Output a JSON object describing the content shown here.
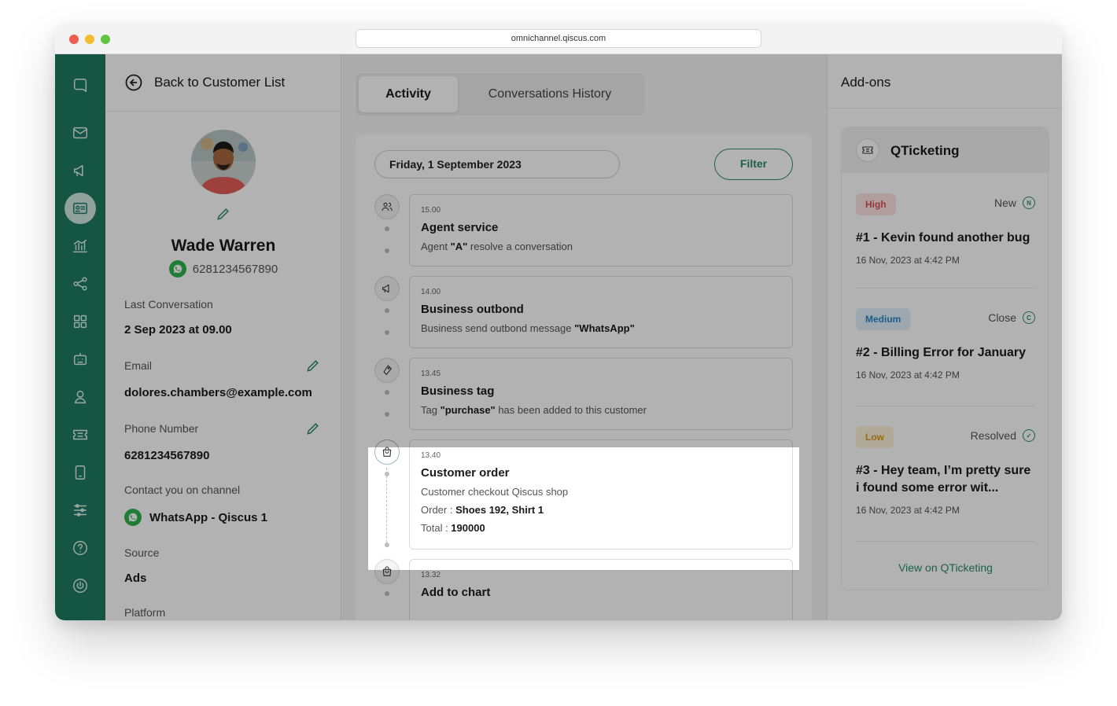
{
  "browser": {
    "url": "omnichannel.qiscus.com"
  },
  "nav": {
    "items": [
      "logo",
      "mail",
      "broadcast",
      "contacts",
      "analytics",
      "integrations",
      "apps",
      "bot",
      "agents",
      "tickets",
      "mobile",
      "settings",
      "help",
      "power"
    ]
  },
  "profile": {
    "back_label": "Back to Customer List",
    "name": "Wade Warren",
    "phone": "6281234567890",
    "last_conversation_label": "Last Conversation",
    "last_conversation_value": "2 Sep 2023 at 09.00",
    "email_label": "Email",
    "email_value": "dolores.chambers@example.com",
    "phone_label": "Phone Number",
    "phone_value": "6281234567890",
    "channel_label": "Contact you on channel",
    "channel_value": "WhatsApp - Qiscus 1",
    "source_label": "Source",
    "source_value": "Ads",
    "platform_label": "Platform"
  },
  "activity": {
    "tabs": [
      "Activity",
      "Conversations History"
    ],
    "date": "Friday, 1 September 2023",
    "filter_label": "Filter",
    "events": [
      {
        "icon": "users-icon",
        "time": "15.00",
        "title": "Agent service",
        "desc_prefix": "Agent ",
        "desc_bold": "\"A\"",
        "desc_suffix": " resolve a conversation"
      },
      {
        "icon": "megaphone-icon",
        "time": "14.00",
        "title": "Business outbond",
        "desc_prefix": "Business send outbond message ",
        "desc_bold": "\"WhatsApp\"",
        "desc_suffix": ""
      },
      {
        "icon": "tag-icon",
        "time": "13.45",
        "title": "Business tag",
        "desc_prefix": "Tag ",
        "desc_bold": "\"purchase\"",
        "desc_suffix": " has been added to this customer"
      },
      {
        "icon": "shopping-bag-icon",
        "time": "13.40",
        "title": "Customer order",
        "desc": "Customer checkout Qiscus shop",
        "order_label": "Order : ",
        "order_value": "Shoes 192, Shirt 1",
        "total_label": "Total : ",
        "total_value": "190000"
      },
      {
        "icon": "shopping-bag-icon",
        "time": "13.32",
        "title": "Add to chart"
      }
    ]
  },
  "addons": {
    "title": "Add-ons",
    "qticketing": {
      "title": "QTicketing",
      "tickets": [
        {
          "priority": "High",
          "status": "New",
          "status_icon": "N",
          "title": "#1 - Kevin found another bug",
          "date": "16 Nov, 2023 at 4:42 PM"
        },
        {
          "priority": "Medium",
          "status": "Close",
          "status_icon": "C",
          "title": "#2 - Billing Error for January",
          "date": "16 Nov, 2023 at 4:42 PM"
        },
        {
          "priority": "Low",
          "status": "Resolved",
          "status_icon": "✓",
          "title": "#3 - Hey team, I’m pretty sure i found some error wit...",
          "date": "16 Nov, 2023 at 4:42 PM"
        }
      ],
      "view_link": "View on QTicketing"
    }
  },
  "colors": {
    "brand": "#1f7a60",
    "accent": "#2a8c6a"
  }
}
